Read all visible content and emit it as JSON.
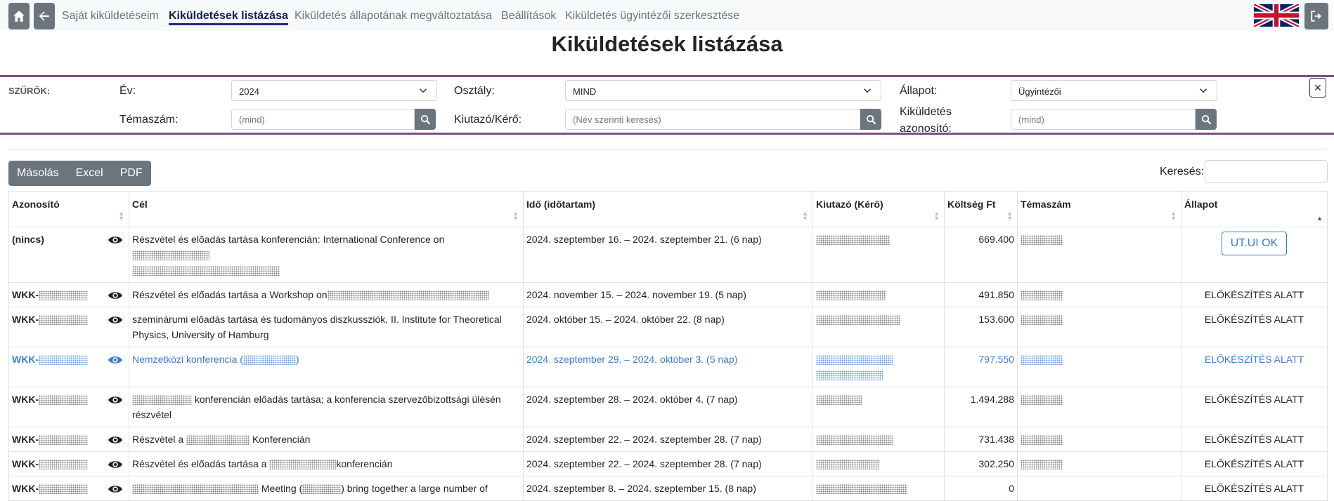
{
  "nav": {
    "links": [
      "Saját kiküldetéseim",
      "Kiküldetések listázása",
      "Kiküldetés állapotának megváltoztatása",
      "Beállítások",
      "Kiküldetés ügyintézői szerkesztése"
    ]
  },
  "page_title": "Kiküldetések listázása",
  "filters": {
    "title": "SZŰRŐK:",
    "year_label": "Év:",
    "year_value": "2024",
    "department_label": "Osztály:",
    "department_value": "MIND",
    "status_label": "Állapot:",
    "status_value": "Ügyintézői",
    "topic_label": "Témaszám:",
    "topic_placeholder": "(mind)",
    "sender_label": "Kiutazó/Kérő:",
    "sender_placeholder": "(Név szerinti keresés)",
    "trip_id_label": "Kiküldetés azonosító:",
    "trip_id_placeholder": "(mind)",
    "close_label": "×"
  },
  "toolbar": {
    "copy": "Másolás",
    "excel": "Excel",
    "pdf": "PDF",
    "search_label": "Keresés:"
  },
  "table": {
    "headers": [
      "Azonosító",
      "Cél",
      "Idő (időtartam)",
      "Kiutazó (Kérő)",
      "Költség Ft",
      "Témaszám",
      "Állapot"
    ],
    "rows": [
      {
        "id": "(nincs)",
        "goal": "Részvétel és előadás tartása konferencián: International Conference on",
        "time": "2024. szeptember 16. – 2024. szeptember 21. (6 nap)",
        "cost": "669.400",
        "status": "UT.UI OK"
      },
      {
        "id": "WKK-",
        "goal": "Részvétel és előadás tartása a Workshop on",
        "time": "2024. november 15. – 2024. november 19. (5 nap)",
        "cost": "491.850",
        "status": "ELŐKÉSZÍTÉS ALATT"
      },
      {
        "id": "WKK-",
        "goal": "szeminárumi előadás tartása és tudományos diszkussziók, II. Institute for Theoretical Physics, University of Hamburg",
        "time": "2024. október 15. – 2024. október 22. (8 nap)",
        "cost": "153.600",
        "status": "ELŐKÉSZÍTÉS ALATT"
      },
      {
        "id": "WKK-",
        "goal": "Nemzetközi konferencia (",
        "goal_end": ")",
        "time": "2024. szeptember 29. – 2024. október 3. (5 nap)",
        "cost": "797.550",
        "status": "ELŐKÉSZÍTÉS ALATT"
      },
      {
        "id": "WKK-",
        "goal": "konferencián előadás tartása; a konferencia szervezőbizottsági ülésén részvétel",
        "time": "2024. szeptember 28. – 2024. október 4. (7 nap)",
        "cost": "1.494.288",
        "status": "ELŐKÉSZÍTÉS ALATT"
      },
      {
        "id": "WKK-",
        "goal": "Részvétel a",
        "goal_end": "Konferencián",
        "time": "2024. szeptember 22. – 2024. szeptember 28. (7 nap)",
        "cost": "731.438",
        "status": "ELŐKÉSZÍTÉS ALATT"
      },
      {
        "id": "WKK-",
        "goal": "Részvétel és előadás tartása a",
        "goal_end": "konferencián",
        "time": "2024. szeptember 22. – 2024. szeptember 28. (7 nap)",
        "cost": "302.250",
        "status": "ELŐKÉSZÍTÉS ALATT"
      },
      {
        "id": "WKK-",
        "goal": "Meeting (",
        "goal_end": ") bring together a large number of",
        "time": "2024. szeptember 8. – 2024. szeptember 15. (8 nap)",
        "cost": "0",
        "status": "ELŐKÉSZÍTÉS ALATT"
      }
    ]
  }
}
